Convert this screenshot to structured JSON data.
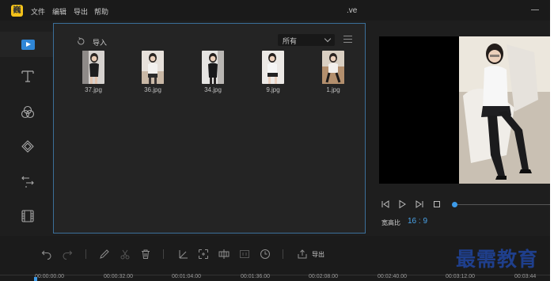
{
  "app": {
    "logo_text": "巍",
    "title": ".ve",
    "menu": [
      "文件",
      "编辑",
      "导出",
      "帮助"
    ]
  },
  "sidebar": {
    "items": [
      {
        "name": "media",
        "icon": "media-icon",
        "active": true
      },
      {
        "name": "text",
        "icon": "text-icon"
      },
      {
        "name": "filters",
        "icon": "filter-icon"
      },
      {
        "name": "overlays",
        "icon": "overlay-icon"
      },
      {
        "name": "transitions",
        "icon": "transition-icon"
      },
      {
        "name": "elements",
        "icon": "film-icon"
      }
    ]
  },
  "media": {
    "import_label": "导入",
    "filter_value": "所有",
    "files": [
      "37.jpg",
      "36.jpg",
      "34.jpg",
      "9.jpg",
      "1.jpg"
    ]
  },
  "preview": {
    "ratio_label": "宽高比",
    "ratio_value": "16 : 9",
    "progress": 0
  },
  "toolbar": {
    "export_label": "导出"
  },
  "timeline": {
    "ticks": [
      "00:00:00.00",
      "00:00:32.00",
      "00:01:04.00",
      "00:01:36.00",
      "00:02:08.00",
      "00:02:40.00",
      "00:03:12.00",
      "00:03:44"
    ]
  },
  "watermark": "最需教育",
  "colors": {
    "accent": "#3d9be9",
    "panel_border": "#3b6f9a",
    "logo": "#f4c21a",
    "watermark": "#1f3f8c"
  }
}
